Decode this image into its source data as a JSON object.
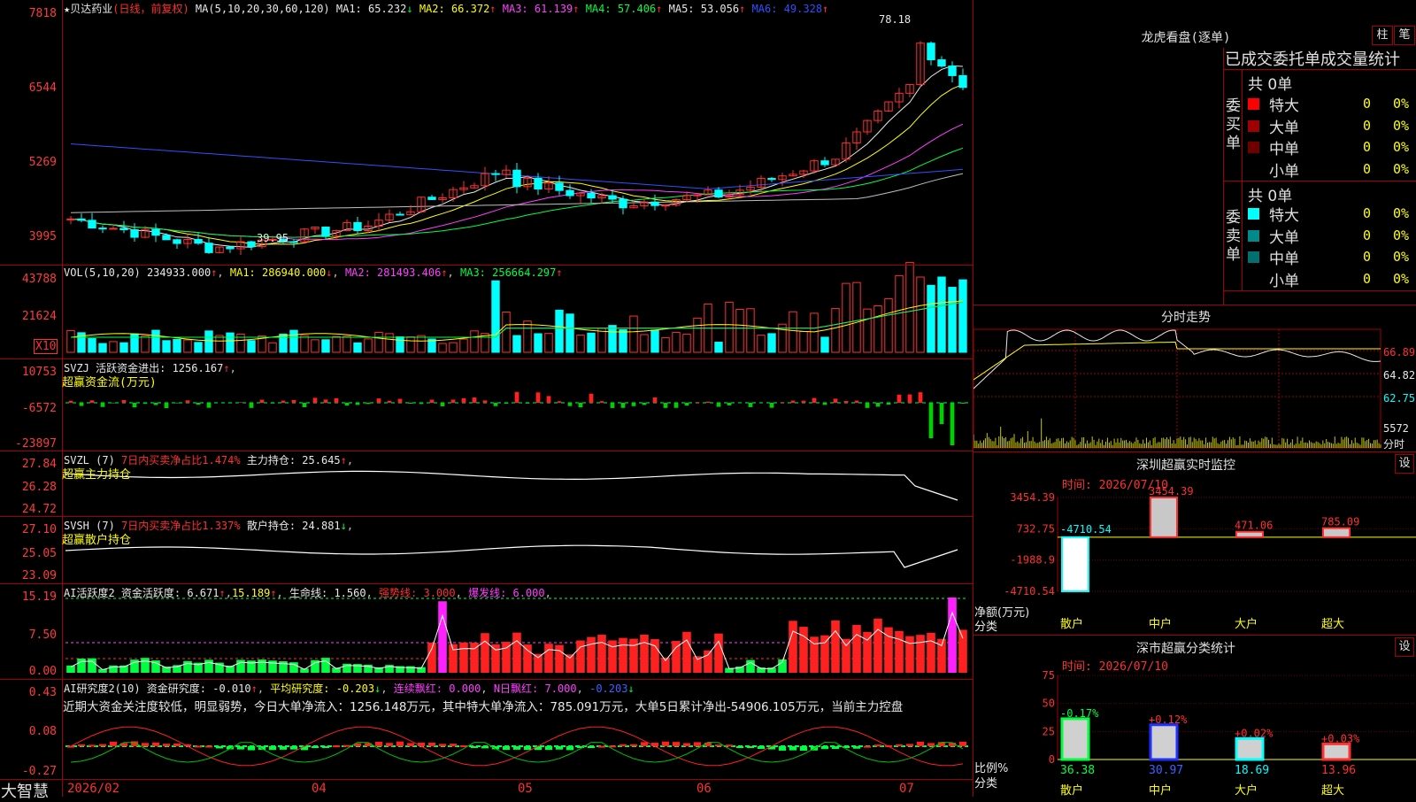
{
  "app": {
    "brand": "大智慧"
  },
  "kline": {
    "stock": "★贝达药业",
    "period": "(日线，前复权)",
    "ma_header": "MA(5,10,20,30,60,120)",
    "ma": [
      {
        "label": "MA1:",
        "value": "65.232",
        "arrow": "↓",
        "color": "#e8e8e8"
      },
      {
        "label": "MA2:",
        "value": "66.372",
        "arrow": "↑",
        "color": "#ffff00"
      },
      {
        "label": "MA3:",
        "value": "61.139",
        "arrow": "↑",
        "color": "#ff40ff"
      },
      {
        "label": "MA4:",
        "value": "57.406",
        "arrow": "↑",
        "color": "#00ff40"
      },
      {
        "label": "MA5:",
        "value": "53.056",
        "arrow": "↑",
        "color": "#e8e8e8"
      },
      {
        "label": "MA6:",
        "value": "49.328",
        "arrow": "↑",
        "color": "#3050ff"
      }
    ],
    "yticks": [
      "7818",
      "6544",
      "5269",
      "3995"
    ],
    "high_label": "78.18",
    "low_label": "39.95"
  },
  "vol": {
    "header": "VOL(5,10,20)",
    "value": "234933.000",
    "ma1": "MA1: 286940.000",
    "ma2": "MA2: 281493.406",
    "ma3": "MA3: 256664.297",
    "yticks": [
      "43788",
      "21624"
    ],
    "unit": "X10"
  },
  "svzj": {
    "header": "SVZJ  活跃资金进出: 1256.167",
    "sub": "超赢资金流(万元)",
    "yticks": [
      "10753",
      "-6572",
      "-23897"
    ]
  },
  "svzl": {
    "header_a": "SVZL (7)",
    "header_b": "7日内买卖净占比1.474%",
    "header_c": "主力持仓: 25.645",
    "sub": "超赢主力持仓",
    "yticks": [
      "27.84",
      "26.28",
      "24.72"
    ]
  },
  "svsh": {
    "header_a": "SVSH (7)",
    "header_b": "7日内买卖净占比1.337%",
    "header_c": "散户持仓: 24.881",
    "sub": "超赢散户持仓",
    "yticks": [
      "27.10",
      "25.05",
      "23.09"
    ]
  },
  "ai1": {
    "header_a": "AI活跃度2 资金活跃度: 6.671",
    "header_b": "15.189",
    "header_c": "生命线: 1.560",
    "header_d": "强势线: 3.000",
    "header_e": "爆发线: 6.000",
    "yticks": [
      "15.19",
      "7.50",
      "0.00"
    ]
  },
  "ai2": {
    "header_a": "AI研究度2(10) 资金研究度: -0.010",
    "header_b": "平均研究度: -0.203",
    "header_c": "连续飘红: 0.000",
    "header_d": "N日飘红: 7.000",
    "header_e": "-0.203",
    "desc": "近期大资金关注度较低，明显弱势，今日大单净流入：1256.148万元，其中特大单净流入：785.091万元，大单5日累计净出-54906.105万元，当前主力控盘",
    "yticks": [
      "0.43",
      "0.08",
      "-0.27"
    ]
  },
  "xaxis": [
    "2026/02",
    "04",
    "05",
    "06",
    "07"
  ],
  "longhu": {
    "title": "龙虎看盘(逐单)",
    "btn1": "柱",
    "btn2": "笔",
    "subtitle": "已成交委托单成交量统计",
    "buy_label": "委买单",
    "sell_label": "委卖单",
    "buy_total": "共 0单",
    "sell_total": "共 0单",
    "buy_rows": [
      {
        "name": "特大",
        "count": "0",
        "pct": "0%",
        "color": "#ff0000"
      },
      {
        "name": "大单",
        "count": "0",
        "pct": "0%",
        "color": "#a00000"
      },
      {
        "name": "中单",
        "count": "0",
        "pct": "0%",
        "color": "#700000"
      },
      {
        "name": "小单",
        "count": "0",
        "pct": "0%",
        "color": ""
      }
    ],
    "sell_rows": [
      {
        "name": "特大",
        "count": "0",
        "pct": "0%",
        "color": "#00ffff"
      },
      {
        "name": "大单",
        "count": "0",
        "pct": "0%",
        "color": "#008a8a"
      },
      {
        "name": "中单",
        "count": "0",
        "pct": "0%",
        "color": "#007070"
      },
      {
        "name": "小单",
        "count": "0",
        "pct": "0%",
        "color": ""
      }
    ]
  },
  "fenshi": {
    "title": "分时走势",
    "yticks": [
      "66.89",
      "64.82",
      "62.75"
    ],
    "vol_label": "5572",
    "unit": "分时"
  },
  "monitor": {
    "title": "深圳超赢实时监控",
    "btn": "设",
    "time": "时间: 2026/07/10",
    "yticks": [
      "3454.39",
      "732.75",
      "-1988.9",
      "-4710.54"
    ],
    "ylabel": "净额(万元)",
    "ylabel2": "分类",
    "categories": [
      "散户",
      "中户",
      "大户",
      "超大"
    ],
    "values": [
      "-4710.54",
      "3454.39",
      "471.06",
      "785.09"
    ]
  },
  "classify": {
    "title": "深市超赢分类统计",
    "btn": "设",
    "time": "时间: 2026/07/10",
    "yticks": [
      "75",
      "50",
      "25",
      "0"
    ],
    "ylabel": "比例%",
    "ylabel2": "分类",
    "categories": [
      "散户",
      "中户",
      "大户",
      "超大"
    ],
    "changes": [
      "-0.17%",
      "+0.12%",
      "+0.02%",
      "+0.03%"
    ],
    "values": [
      "36.38",
      "30.97",
      "18.69",
      "13.96"
    ]
  },
  "chart_data": [
    {
      "type": "bar",
      "title": "深圳超赢实时监控",
      "ylabel": "净额(万元)",
      "xlabel": "分类",
      "categories": [
        "散户",
        "中户",
        "大户",
        "超大"
      ],
      "values": [
        -4710.54,
        3454.39,
        471.06,
        785.09
      ],
      "ylim": [
        -4710.54,
        3454.39
      ]
    },
    {
      "type": "bar",
      "title": "深市超赢分类统计",
      "ylabel": "比例%",
      "xlabel": "分类",
      "categories": [
        "散户",
        "中户",
        "大户",
        "超大"
      ],
      "values": [
        36.38,
        30.97,
        18.69,
        13.96
      ],
      "changes": [
        -0.17,
        0.12,
        0.02,
        0.03
      ],
      "ylim": [
        0,
        75
      ]
    },
    {
      "type": "line",
      "title": "贝达药业 日线",
      "x": [
        "2026/02",
        "04",
        "05",
        "06",
        "07"
      ],
      "ylim": [
        39.95,
        78.18
      ],
      "series": [
        {
          "name": "MA1",
          "last": 65.232
        },
        {
          "name": "MA2",
          "last": 66.372
        },
        {
          "name": "MA3",
          "last": 61.139
        },
        {
          "name": "MA4",
          "last": 57.406
        },
        {
          "name": "MA5",
          "last": 53.056
        },
        {
          "name": "MA6",
          "last": 49.328
        }
      ]
    }
  ]
}
